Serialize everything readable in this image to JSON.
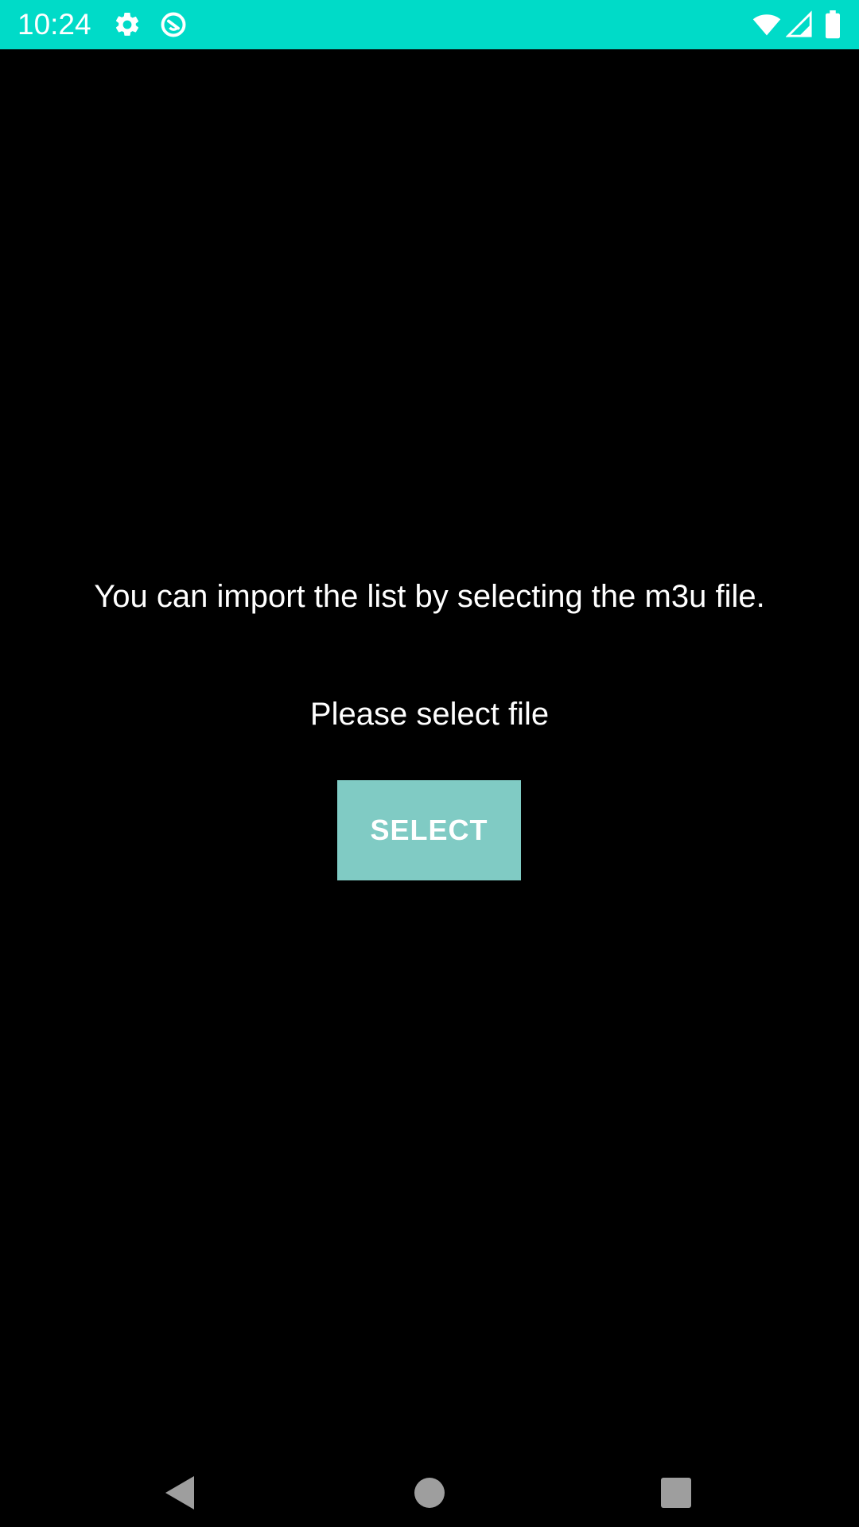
{
  "status_bar": {
    "time": "10:24",
    "icons": [
      "gear-icon",
      "sync-circle-icon",
      "wifi-icon",
      "signal-icon",
      "battery-icon"
    ],
    "background": "#00dbc8"
  },
  "main": {
    "intro": "You can import the list by selecting the m3u file.",
    "prompt": "Please select file",
    "select_button_label": "SELECT",
    "button_color": "#80cbc4"
  },
  "nav_bar": {
    "buttons": [
      "back-icon",
      "home-icon",
      "recents-icon"
    ]
  }
}
